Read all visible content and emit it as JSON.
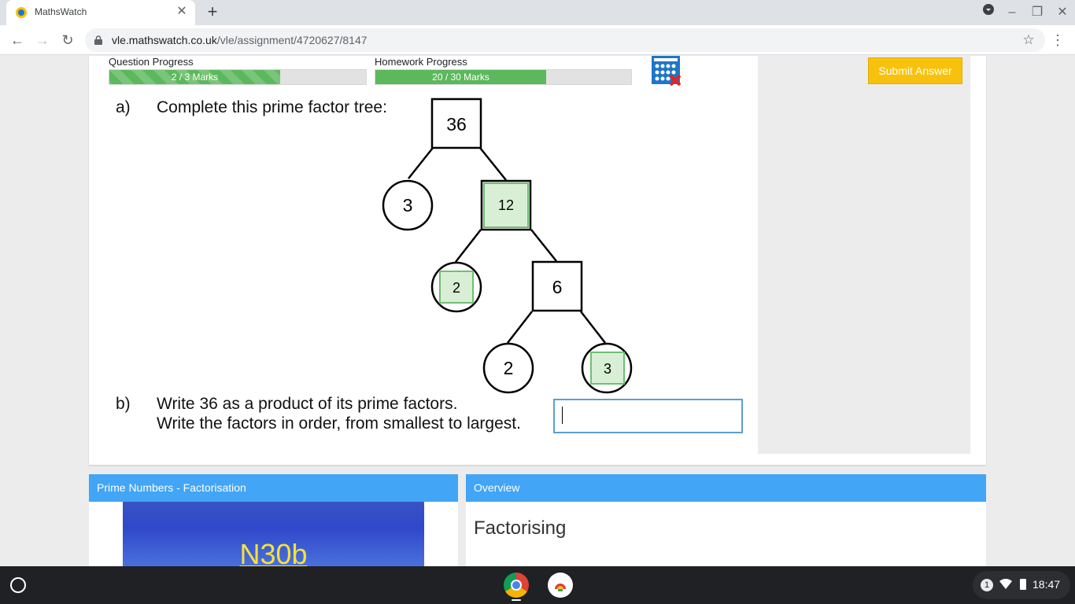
{
  "browser": {
    "tab_title": "MathsWatch",
    "url_host": "vle.mathswatch.co.uk",
    "url_path": "/vle/assignment/4720627/8147",
    "icons": {
      "favicon": "mathswatch-logo-icon",
      "close": "close-icon",
      "new_tab": "plus-icon",
      "back": "arrow-left-icon",
      "forward": "arrow-right-icon",
      "reload": "reload-icon",
      "lock": "lock-icon",
      "bookmark": "star-icon",
      "menu": "kebab-menu-icon"
    }
  },
  "progress": {
    "question": {
      "label": "Question Progress",
      "text": "2 / 3 Marks",
      "fraction": 0.667
    },
    "homework": {
      "label": "Homework Progress",
      "text": "20 / 30 Marks",
      "fraction": 0.667
    },
    "calculator_icon": "calculator-not-allowed-icon"
  },
  "submit_label": "Submit Answer",
  "question": {
    "part_a_label": "a)",
    "part_a_text": "Complete this prime factor tree:",
    "part_b_label": "b)",
    "part_b_line1": "Write 36 as a product of its prime factors.",
    "part_b_line2": "Write the factors in order, from smallest to largest.",
    "answer_value": "",
    "tree": {
      "root": "36",
      "level1_prime": "3",
      "level1_composite_answer": "12",
      "level2_prime_answer": "2",
      "level2_composite": "6",
      "level3_prime": "2",
      "level3_prime_answer": "3"
    }
  },
  "video_panel": {
    "title": "Prime Numbers - Factorisation",
    "thumbnail_text": "N30b"
  },
  "overview_panel": {
    "title": "Overview",
    "heading": "Factorising"
  },
  "taskbar": {
    "notification_count": "1",
    "time": "18:47",
    "icons": {
      "launcher": "launcher-icon",
      "wifi": "wifi-icon",
      "battery": "battery-icon"
    }
  },
  "colors": {
    "progress_green": "#5cb85c",
    "submit_yellow": "#f8c20c",
    "panel_blue": "#42a5f5",
    "answer_box_green": "#d9efd5"
  }
}
